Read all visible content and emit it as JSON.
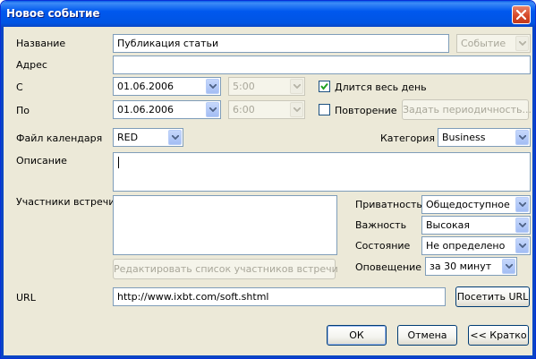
{
  "window": {
    "title": "Новое событие"
  },
  "labels": {
    "name": "Название",
    "address": "Адрес",
    "from": "С",
    "to": "По",
    "calendar_file": "Файл календаря",
    "category": "Категория",
    "description": "Описание",
    "attendees": "Участники встречи",
    "privacy": "Приватность",
    "importance": "Важность",
    "status": "Состояние",
    "alarm": "Оповещение",
    "url": "URL"
  },
  "fields": {
    "name_value": "Публикация статьи",
    "event_type": "Событие",
    "address_value": "",
    "start_date": "01.06.2006",
    "start_time": "5:00",
    "end_date": "01.06.2006",
    "end_time": "6:00",
    "calendar_file": "RED",
    "category": "Business",
    "description_value": "",
    "privacy": "Общедоступное",
    "importance": "Высокая",
    "status": "Не определено",
    "alarm": "за 30 минут",
    "url_value": "http://www.ixbt.com/soft.shtml"
  },
  "checkboxes": {
    "all_day": {
      "label": "Длится весь день",
      "checked": true
    },
    "repeat": {
      "label": "Повторение",
      "checked": false
    }
  },
  "buttons": {
    "set_recurrence": "Задать периодичность...",
    "edit_attendees": "Редактировать список участников встречи",
    "visit_url": "Посетить URL",
    "ok": "ОК",
    "cancel": "Отмена",
    "brief": "<< Кратко"
  }
}
